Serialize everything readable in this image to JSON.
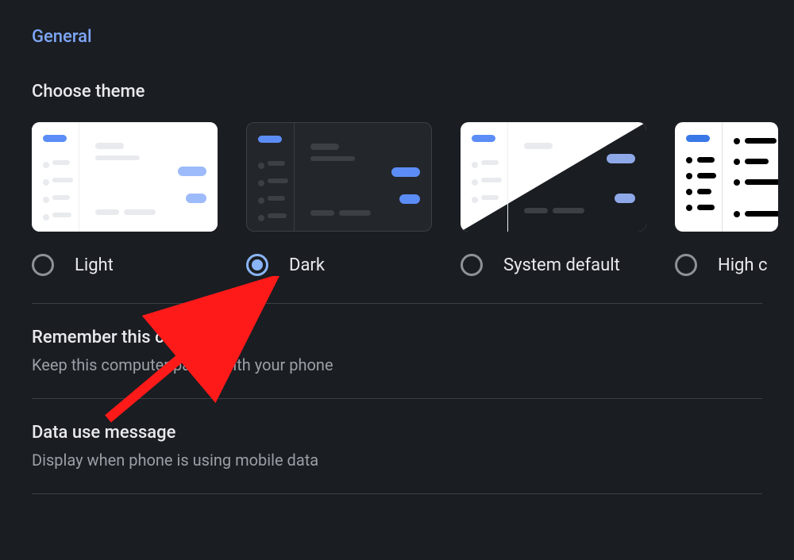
{
  "section_title": "General",
  "choose_theme_label": "Choose theme",
  "themes": {
    "light": {
      "label": "Light",
      "selected": false
    },
    "dark": {
      "label": "Dark",
      "selected": true
    },
    "system": {
      "label": "System default",
      "selected": false
    },
    "hc": {
      "label": "High c",
      "selected": false
    }
  },
  "settings": {
    "remember": {
      "title": "Remember this computer",
      "desc": "Keep this computer paired with your phone"
    },
    "data_use": {
      "title": "Data use message",
      "desc": "Display when phone is using mobile data"
    }
  },
  "colors": {
    "accent": "#8ab4f8",
    "link": "#7ea6f7",
    "bg": "#1a1d22",
    "muted": "#9aa0a6"
  }
}
